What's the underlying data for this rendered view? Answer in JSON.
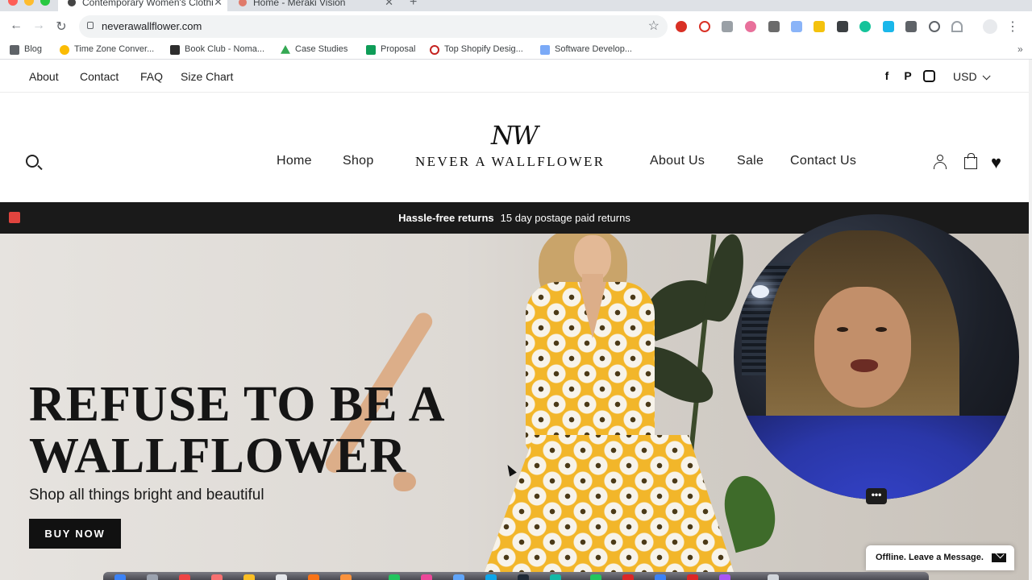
{
  "browser": {
    "tabs": [
      {
        "title": "Contemporary Women's Clothi",
        "active": true
      },
      {
        "title": "Home - Meraki Vision",
        "active": false
      }
    ],
    "close_glyph": "✕",
    "new_tab_glyph": "+",
    "url": "neverawallflower.com",
    "bookmarks": [
      "Blog",
      "Time Zone Conver...",
      "Book Club - Noma...",
      "Case Studies",
      "Proposal",
      "Top Shopify Desig...",
      "Software Develop..."
    ],
    "more_glyph": "⋮"
  },
  "site": {
    "utility_links": [
      "About",
      "Contact",
      "FAQ",
      "Size Chart"
    ],
    "social_icons": [
      "facebook-icon",
      "pinterest-icon",
      "instagram-icon"
    ],
    "currency": "USD",
    "nav_left": [
      "Home",
      "Shop"
    ],
    "nav_right": [
      "About Us",
      "Sale",
      "Contact Us"
    ],
    "logo_monogram": "NW",
    "logo_text": "NEVER A WALLFLOWER",
    "announcement": {
      "bold": "Hassle-free returns",
      "text": "15 day postage paid returns"
    },
    "hero": {
      "headline_line1": "REFUSE TO BE A",
      "headline_line2": "WALLFLOWER",
      "subheading": "Shop all things bright and beautiful",
      "cta": "BUY NOW"
    },
    "chat_widget": "Offline. Leave a Message.",
    "webcam_menu": "•••"
  },
  "colors": {
    "announcement_bg": "#1a1a1a",
    "cta_bg": "#111111",
    "dress_yellow": "#f2b62a",
    "record_red": "#e0443e"
  }
}
